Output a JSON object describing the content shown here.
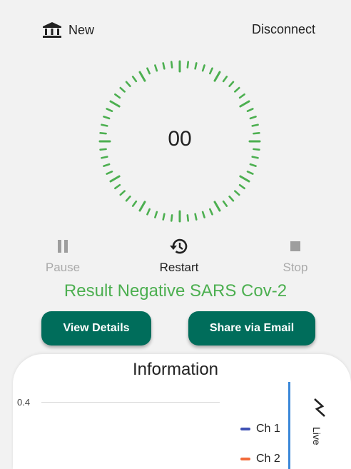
{
  "header": {
    "new_label": "New",
    "disconnect_label": "Disconnect"
  },
  "timer": {
    "value": "00",
    "accent_color": "#4caf50"
  },
  "controls": {
    "pause_label": "Pause",
    "restart_label": "Restart",
    "stop_label": "Stop"
  },
  "result": {
    "text": "Result Negative SARS Cov-2",
    "color": "#4caf50"
  },
  "actions": {
    "view_details_label": "View Details",
    "share_email_label": "Share via Email",
    "button_color": "#006d5b"
  },
  "information": {
    "title": "Information",
    "y_tick": "0.4",
    "legend": [
      {
        "name": "Ch 1",
        "color": "#3f51b5"
      },
      {
        "name": "Ch 2",
        "color": "#f26b3a"
      }
    ],
    "live_label": "Live",
    "cursor_color": "#3b88d8"
  },
  "icons": {
    "new": "bank-icon",
    "pause": "pause-icon",
    "restart": "history-icon",
    "stop": "stop-icon",
    "live": "trending-icon"
  }
}
